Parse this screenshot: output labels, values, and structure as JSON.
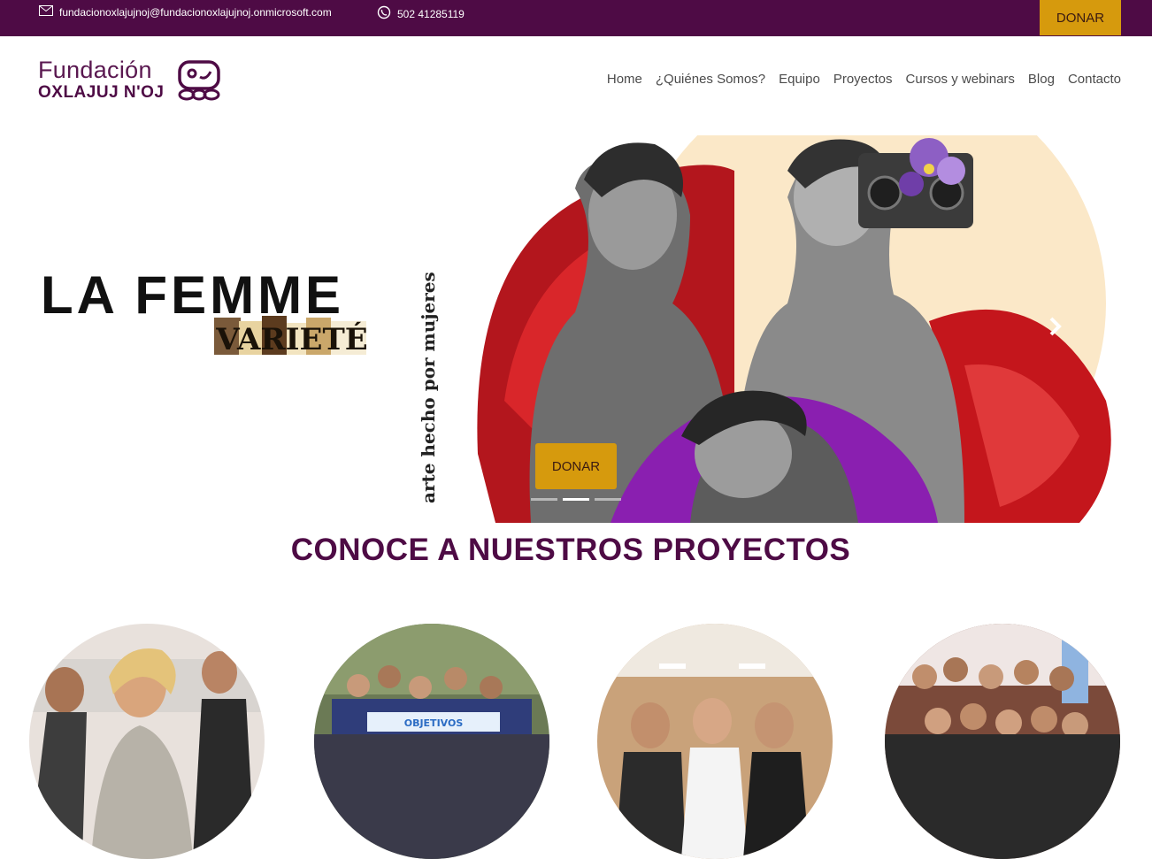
{
  "topbar": {
    "email": "fundacionoxlajujnoj@fundacionoxlajujnoj.onmicrosoft.com",
    "phone": "502 41285119",
    "donate_label": "DONAR",
    "icons": [
      "mail-icon",
      "whatsapp-icon"
    ]
  },
  "header": {
    "logo_line1": "Fundación",
    "logo_line2": "OXLAJUJ N'OJ",
    "nav": [
      "Home",
      "¿Quiénes Somos?",
      "Equipo",
      "Proyectos",
      "Cursos y webinars",
      "Blog",
      "Contacto"
    ]
  },
  "hero": {
    "title": "LA FEMME",
    "subtitle": "VARIETÉ",
    "vertical_text": "arte hecho por mujeres",
    "donate_label": "DONAR",
    "slides_total": 3,
    "active_slide": 2,
    "next_icon": "chevron-right-icon"
  },
  "projects": {
    "title": "CONOCE A NUESTROS PROYECTOS",
    "items": [
      "project-photo-1",
      "project-photo-2",
      "project-photo-3",
      "project-photo-4"
    ]
  },
  "colors": {
    "brand_purple": "#4e0b45",
    "accent_gold": "#d69a0d",
    "nav_text": "#4b4b4b"
  }
}
